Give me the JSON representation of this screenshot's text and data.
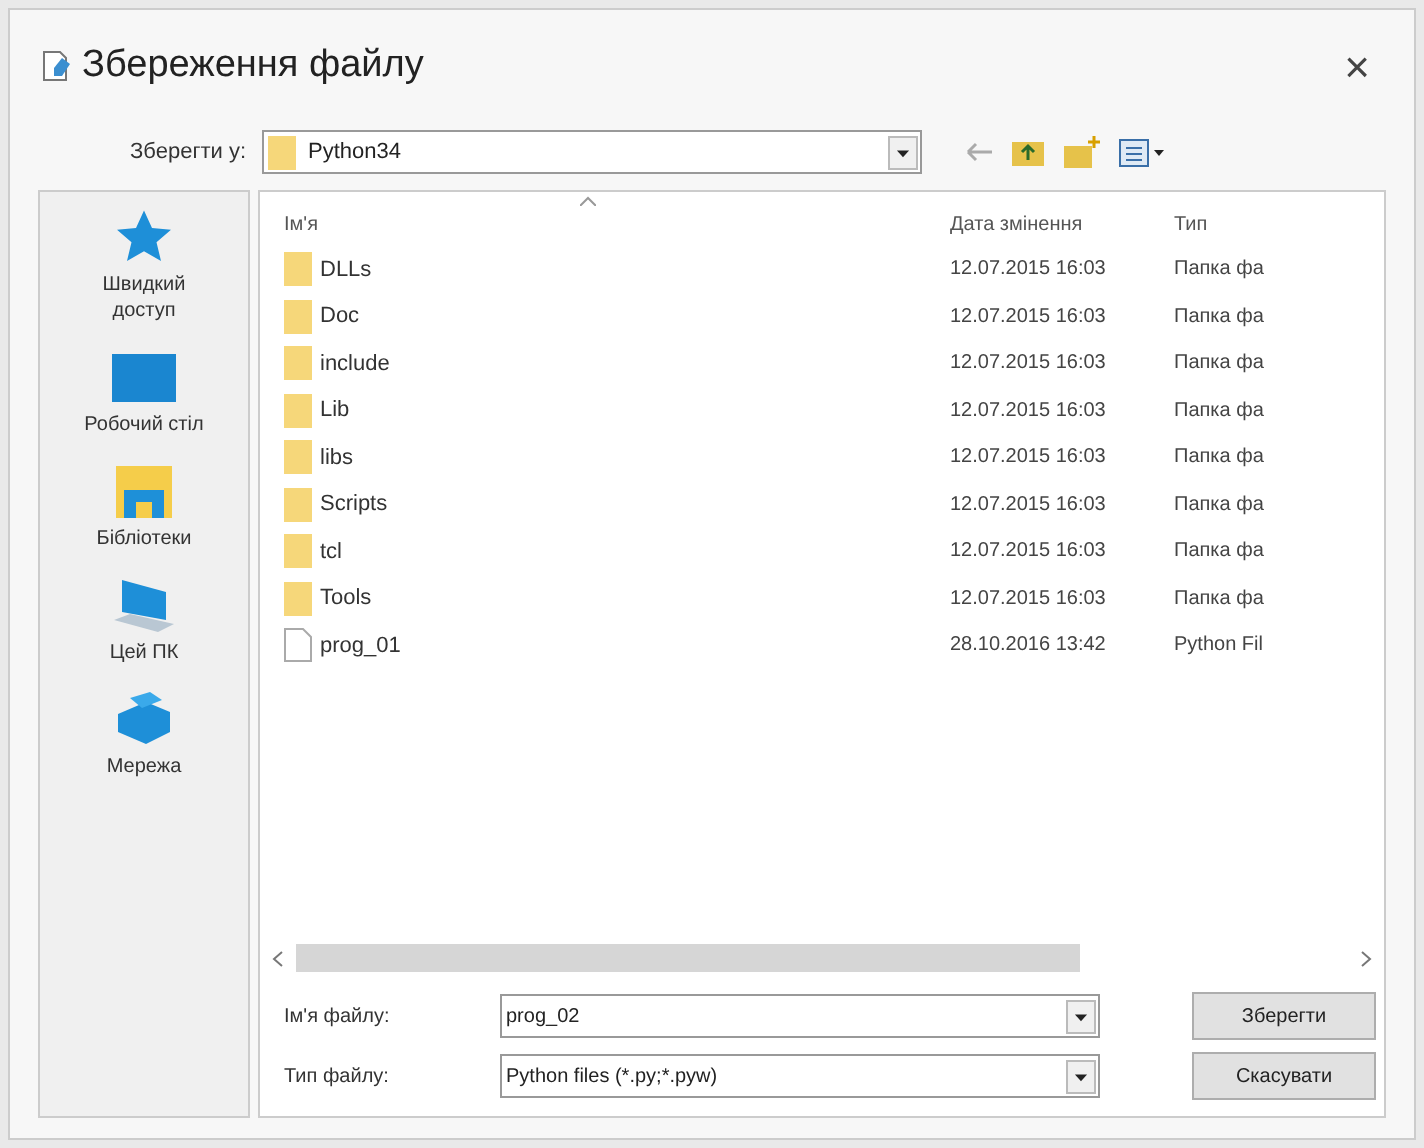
{
  "window": {
    "title": "Збереження файлу",
    "close": "×"
  },
  "save_in": {
    "label": "Зберегти у:",
    "value": "Python34"
  },
  "places": [
    {
      "label": "Швидкий доступ",
      "kind": "star"
    },
    {
      "label": "Робочий стіл",
      "kind": "desktop"
    },
    {
      "label": "Бібліотеки",
      "kind": "library"
    },
    {
      "label": "Цей ПК",
      "kind": "computer"
    },
    {
      "label": "Мережа",
      "kind": "network"
    }
  ],
  "table": {
    "columns": [
      "Ім'я",
      "Дата змінення",
      "Тип"
    ],
    "rows": [
      {
        "name": "DLLs",
        "date": "12.07.2015 16:03",
        "type": "Папка фа",
        "kind": "folder"
      },
      {
        "name": "Doc",
        "date": "12.07.2015 16:03",
        "type": "Папка фа",
        "kind": "folder"
      },
      {
        "name": "include",
        "date": "12.07.2015 16:03",
        "type": "Папка фа",
        "kind": "folder"
      },
      {
        "name": "Lib",
        "date": "12.07.2015 16:03",
        "type": "Папка фа",
        "kind": "folder"
      },
      {
        "name": "libs",
        "date": "12.07.2015 16:03",
        "type": "Папка фа",
        "kind": "folder"
      },
      {
        "name": "Scripts",
        "date": "12.07.2015 16:03",
        "type": "Папка фа",
        "kind": "folder"
      },
      {
        "name": "tcl",
        "date": "12.07.2015 16:03",
        "type": "Папка фа",
        "kind": "folder"
      },
      {
        "name": "Tools",
        "date": "12.07.2015 16:03",
        "type": "Папка фа",
        "kind": "folder"
      },
      {
        "name": "prog_01",
        "date": "28.10.2016 13:42",
        "type": "Python Fil",
        "kind": "file"
      }
    ]
  },
  "file_name": {
    "label": "Ім'я файлу:",
    "value": "prog_02"
  },
  "file_type": {
    "label": "Тип файлу:",
    "value": "Python files (*.py;*.pyw)"
  },
  "buttons": [
    "Зберегти",
    "Скасувати"
  ]
}
